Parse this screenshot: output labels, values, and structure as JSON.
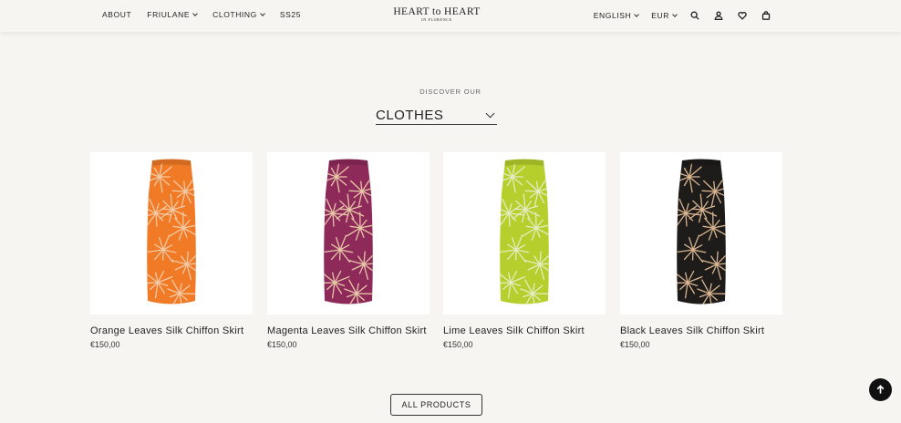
{
  "header": {
    "nav_left": [
      {
        "label": "ABOUT",
        "has_dropdown": false
      },
      {
        "label": "FRIULANE",
        "has_dropdown": true
      },
      {
        "label": "CLOTHING",
        "has_dropdown": true
      },
      {
        "label": "SS25",
        "has_dropdown": false
      }
    ],
    "logo": {
      "main": "HEART to HEART",
      "sub": "IN FLORENCE"
    },
    "language": "ENGLISH",
    "currency": "EUR",
    "icons": [
      "search-icon",
      "account-icon",
      "wishlist-icon",
      "cart-icon"
    ]
  },
  "collection": {
    "eyebrow": "DISCOVER OUR",
    "selected_category": "CLOTHES"
  },
  "products": [
    {
      "name": "Orange Leaves Silk Chiffon Skirt",
      "price": "€150,00",
      "base_color": "#f07a26",
      "leaf_color": "#f4c9a3"
    },
    {
      "name": "Magenta Leaves Silk Chiffon Skirt",
      "price": "€150,00",
      "base_color": "#8e2a5a",
      "leaf_color": "#e7c6a6"
    },
    {
      "name": "Lime Leaves Silk Chiffon Skirt",
      "price": "€150,00",
      "base_color": "#b7cf2c",
      "leaf_color": "#e4ecc2"
    },
    {
      "name": "Black Leaves Silk Chiffon Skirt",
      "price": "€150,00",
      "base_color": "#1d1c1a",
      "leaf_color": "#d9b48f"
    }
  ],
  "cta": {
    "label": "ALL PRODUCTS"
  },
  "colors": {
    "background": "#f6f5f1",
    "text": "#222222",
    "scroll_button": "#111111"
  }
}
